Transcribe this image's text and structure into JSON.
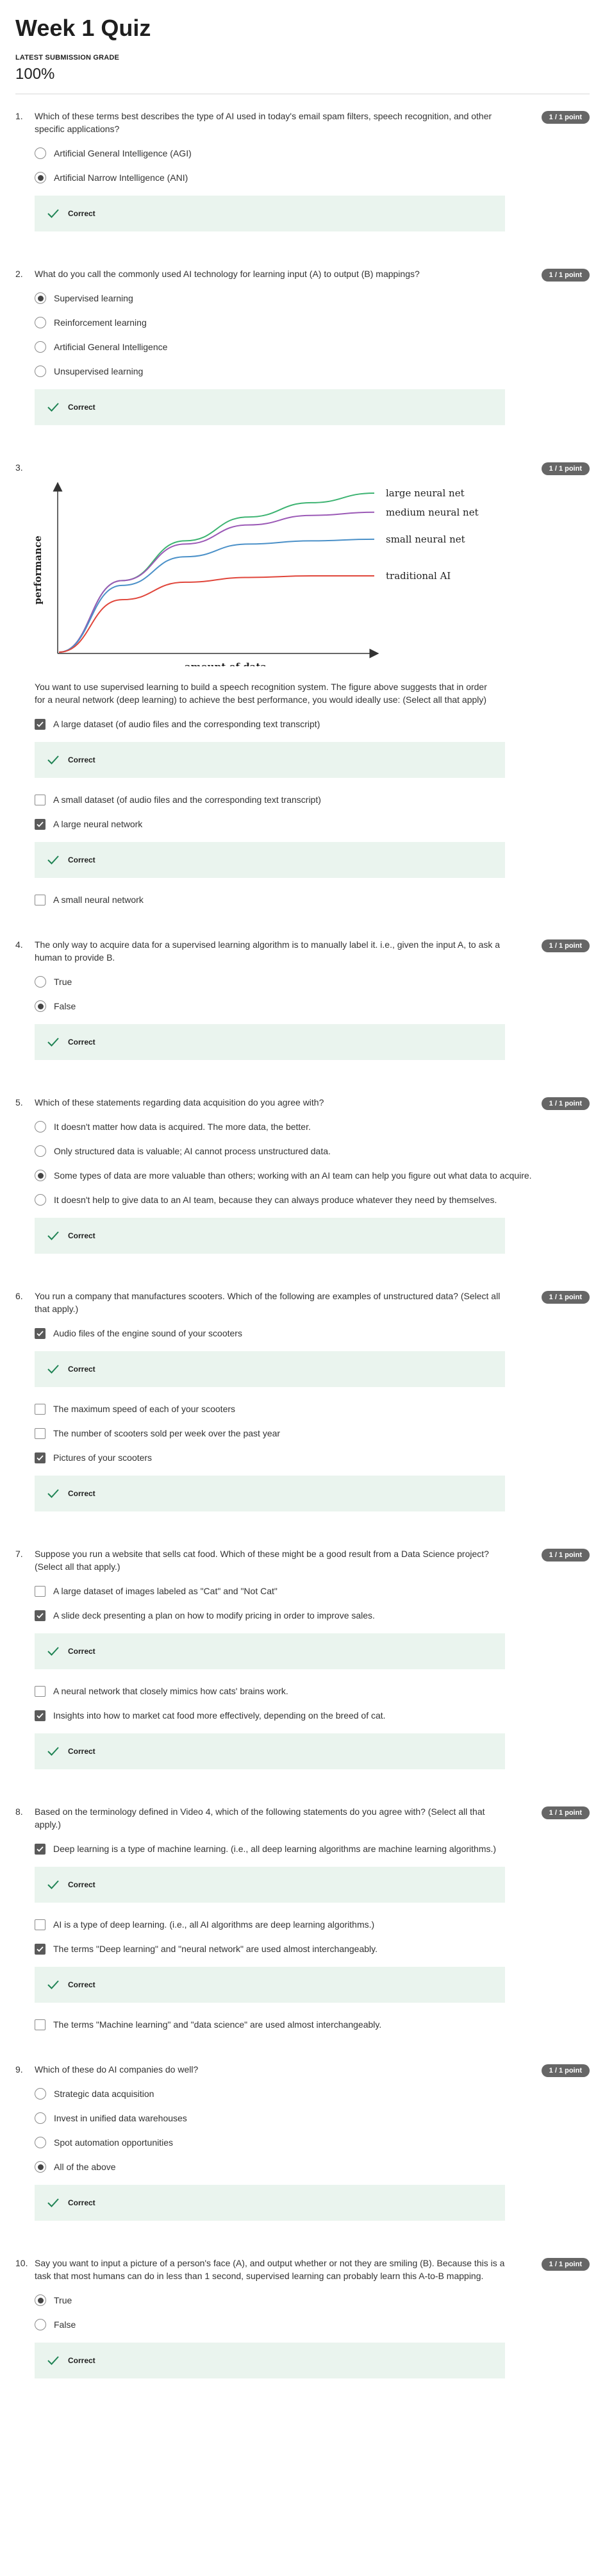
{
  "title": "Week 1 Quiz",
  "grade_label": "LATEST SUBMISSION GRADE",
  "grade_value": "100%",
  "points_label": "1 / 1 point",
  "feedback_label": "Correct",
  "q1": {
    "num": "1.",
    "text": "Which of these terms best describes the type of AI used in today's email spam filters, speech recognition, and other specific applications?",
    "options": [
      "Artificial General Intelligence (AGI)",
      "Artificial Narrow Intelligence (ANI)"
    ]
  },
  "q2": {
    "num": "2.",
    "text": "What do you call the commonly used AI technology for learning input (A) to output (B) mappings?",
    "options": [
      "Supervised learning",
      "Reinforcement learning",
      "Artificial General Intelligence",
      "Unsupervised learning"
    ]
  },
  "q3": {
    "num": "3.",
    "text": "You want to use supervised learning to build a speech recognition system. The figure above suggests that in order for a neural network (deep learning) to achieve the best performance, you would ideally use: (Select all that apply)",
    "options": [
      "A large dataset (of audio files and the corresponding text transcript)",
      "A small dataset (of audio files and the corresponding text transcript)",
      "A large neural network",
      "A small neural network"
    ]
  },
  "q4": {
    "num": "4.",
    "text": "The only way to acquire data for a supervised learning algorithm is to manually label it. i.e., given the input A, to ask a human to provide B.",
    "options": [
      "True",
      "False"
    ]
  },
  "q5": {
    "num": "5.",
    "text": "Which of these statements regarding data acquisition do you agree with?",
    "options": [
      "It doesn't matter how data is acquired. The more data, the better.",
      "Only structured data is valuable; AI cannot process unstructured data.",
      "Some types of data are more valuable than others; working with an AI team can help you figure out what data to acquire.",
      "It doesn't help to give data to an AI team, because they can always produce whatever they need by themselves."
    ]
  },
  "q6": {
    "num": "6.",
    "text": "You run a company that manufactures scooters. Which of the following are examples of unstructured data? (Select all that apply.)",
    "options": [
      "Audio files of the engine sound of your scooters",
      "The maximum speed of each of your scooters",
      "The number of scooters sold per week over the past year",
      "Pictures of your scooters"
    ]
  },
  "q7": {
    "num": "7.",
    "text": "Suppose you run a website that sells cat food. Which of these might be a good result from a Data Science project? (Select all that apply.)",
    "options": [
      "A large dataset of images labeled as \"Cat\" and \"Not Cat\"",
      "A slide deck presenting a plan on how to modify pricing in order to improve sales.",
      "A neural network that closely mimics how cats' brains work.",
      "Insights into how to market cat food more effectively, depending on the breed of cat."
    ]
  },
  "q8": {
    "num": "8.",
    "text": "Based on the terminology defined in Video 4, which of the following statements do you agree with? (Select all that apply.)",
    "options": [
      "Deep learning is a type of machine learning.  (i.e., all deep learning algorithms are machine learning algorithms.)",
      "AI is a type of deep learning. (i.e., all AI algorithms are deep learning algorithms.)",
      "The terms \"Deep learning\" and \"neural network\" are used almost interchangeably.",
      "The terms \"Machine learning\" and \"data science\" are used almost interchangeably."
    ]
  },
  "q9": {
    "num": "9.",
    "text": "Which of these do AI companies do well?",
    "options": [
      "Strategic data acquisition",
      "Invest in unified data warehouses",
      "Spot automation opportunities",
      "All of the above"
    ]
  },
  "q10": {
    "num": "10.",
    "text": "Say you want to input a picture of a person's face (A), and output whether or not they are smiling (B). Because this is a task that most humans can do in less than 1 second, supervised learning can probably learn this A-to-B mapping.",
    "options": [
      "True",
      "False"
    ]
  },
  "chart_data": {
    "type": "line",
    "xlabel": "amount of data",
    "ylabel": "performance",
    "series": [
      {
        "name": "large neural net",
        "color": "#3cb371",
        "values": [
          0,
          0.45,
          0.7,
          0.85,
          0.94,
          1.0
        ]
      },
      {
        "name": "medium neural net",
        "color": "#9b59b6",
        "values": [
          0,
          0.45,
          0.68,
          0.8,
          0.86,
          0.88
        ]
      },
      {
        "name": "small neural net",
        "color": "#4a90c8",
        "values": [
          0,
          0.42,
          0.6,
          0.68,
          0.7,
          0.71
        ]
      },
      {
        "name": "traditional AI",
        "color": "#e0453a",
        "values": [
          0,
          0.33,
          0.44,
          0.47,
          0.48,
          0.48
        ]
      }
    ],
    "grid": false,
    "legend": "inline-right"
  }
}
